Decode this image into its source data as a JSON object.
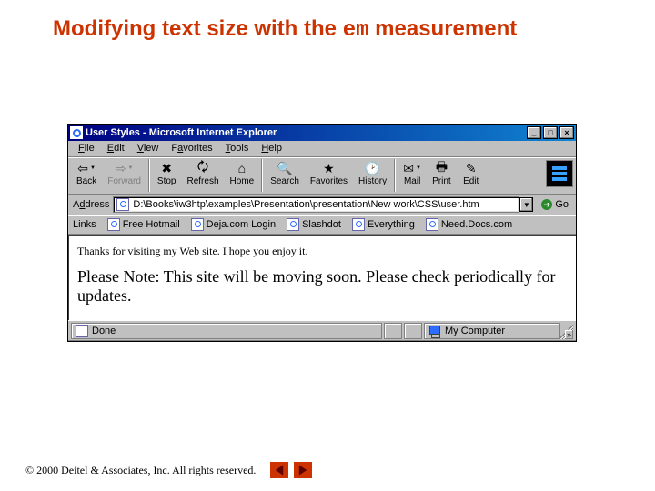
{
  "slide": {
    "title_pre": "Modifying text size with the ",
    "title_em": "em",
    "title_post": " measurement"
  },
  "window": {
    "title": "User Styles - Microsoft Internet Explorer",
    "min": "_",
    "max": "□",
    "close": "×"
  },
  "menu": {
    "file": "File",
    "edit": "Edit",
    "view": "View",
    "favorites": "Favorites",
    "tools": "Tools",
    "help": "Help"
  },
  "toolbar": {
    "back": "Back",
    "forward": "Forward",
    "stop": "Stop",
    "refresh": "Refresh",
    "home": "Home",
    "search": "Search",
    "favorites": "Favorites",
    "history": "History",
    "mail": "Mail",
    "print": "Print",
    "edit": "Edit"
  },
  "address": {
    "label": "Address",
    "value": "D:\\Books\\iw3htp\\examples\\Presentation\\presentation\\New work\\CSS\\user.htm",
    "go": "Go"
  },
  "links": {
    "label": "Links",
    "items": [
      "Free Hotmail",
      "Deja.com Login",
      "Slashdot",
      "Everything",
      "Need.Docs.com"
    ]
  },
  "page": {
    "p1": "Thanks for visiting my Web site. I hope you enjoy it.",
    "p2": "Please Note: This site will be moving soon. Please check periodically for updates."
  },
  "status": {
    "done": "Done",
    "zone": "My Computer"
  },
  "footer": {
    "copyright": "2000 Deitel & Associates, Inc.  All rights reserved."
  }
}
